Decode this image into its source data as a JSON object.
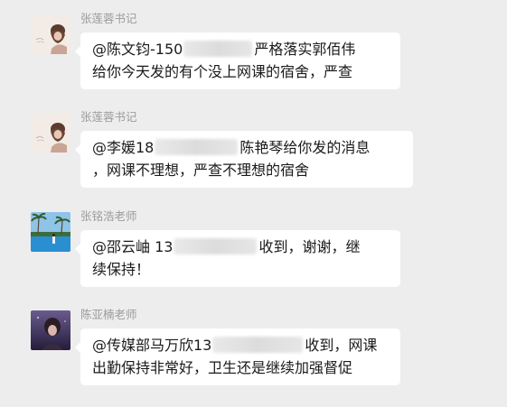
{
  "messages": [
    {
      "sender": "张莲蓉书记",
      "avatar_icon": "woman-portrait-avatar",
      "line1_pre": "@陈文钧-150",
      "line1_post": "严格落实郭佰伟",
      "line2": "给你今天发的有个没上网课的宿舍，严查"
    },
    {
      "sender": "张莲蓉书记",
      "avatar_icon": "woman-portrait-avatar",
      "line1_pre": "@李媛18",
      "line1_post": "陈艳琴给你发的消息",
      "line2": "，网课不理想，严查不理想的宿舍"
    },
    {
      "sender": "张铭浩老师",
      "avatar_icon": "pool-palm-trees-avatar",
      "line1_pre": "@邵云岫 13",
      "line1_post": "收到，谢谢，继",
      "line2": "续保持！"
    },
    {
      "sender": "陈亚楠老师",
      "avatar_icon": "night-portrait-avatar",
      "line1_pre": "@传媒部马万欣13",
      "line1_post": "收到，网课",
      "line2": "出勤保持非常好，卫生还是继续加强督促"
    }
  ],
  "colors": {
    "background": "#ededed",
    "bubble": "#ffffff",
    "sender_name": "#9b9b9b",
    "text": "#1a1a1a"
  }
}
